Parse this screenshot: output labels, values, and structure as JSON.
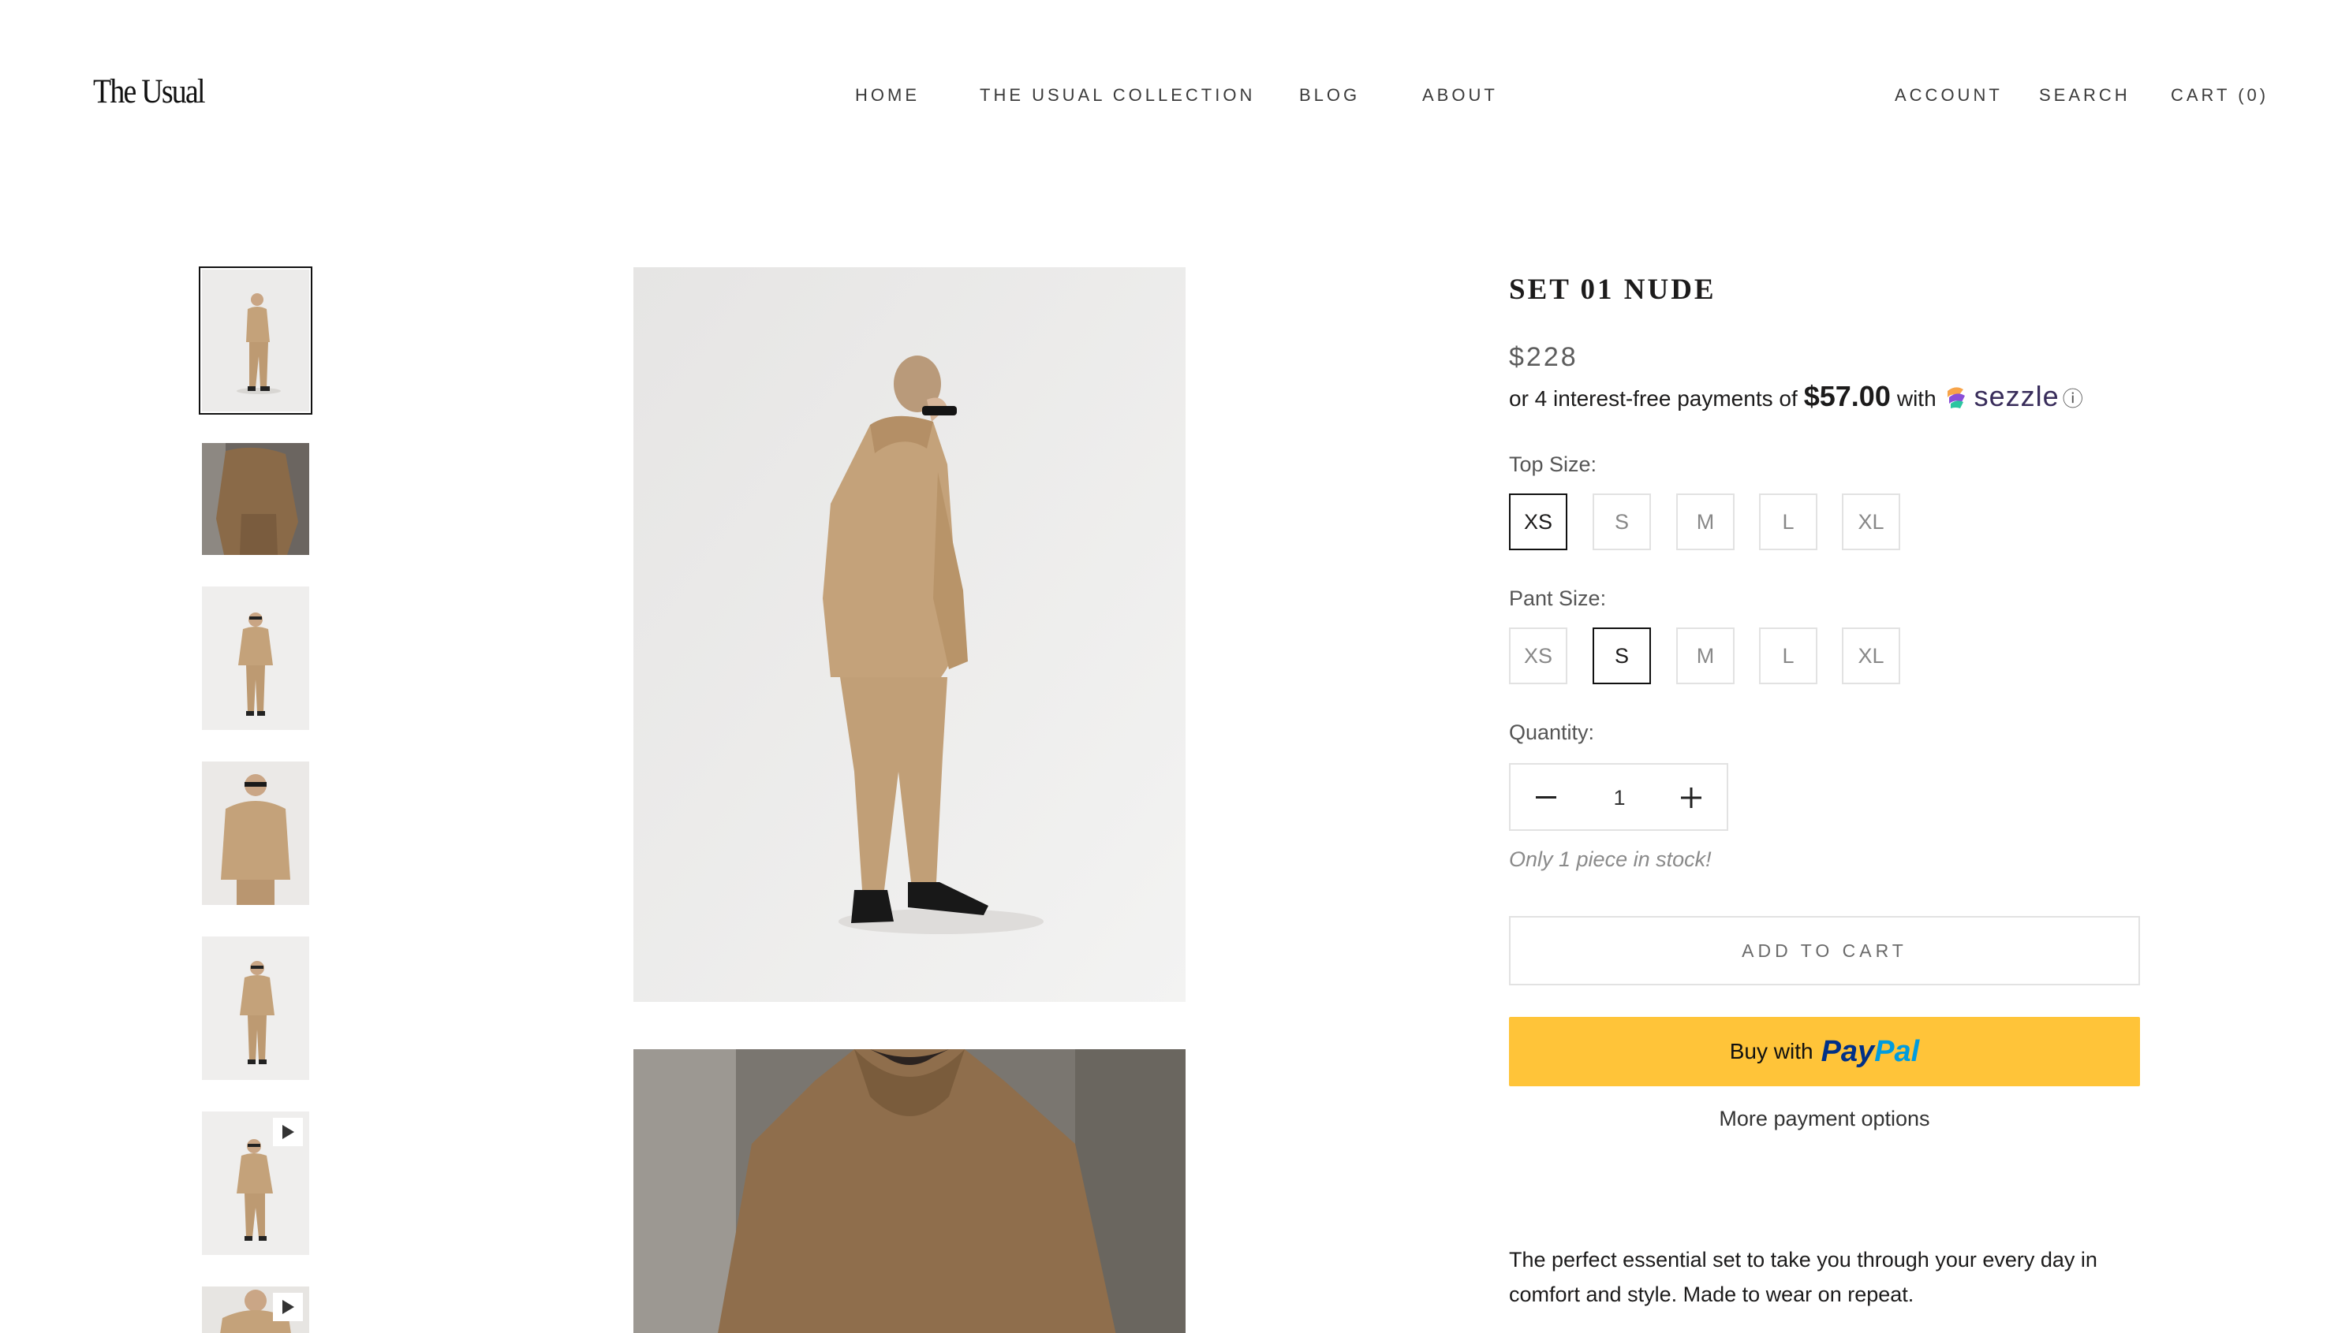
{
  "header": {
    "logo": "The Usual",
    "nav": [
      "HOME",
      "THE USUAL COLLECTION",
      "BLOG",
      "ABOUT"
    ],
    "account": "ACCOUNT",
    "search": "SEARCH",
    "cart": "CART (0)"
  },
  "gallery": {
    "thumbnail_count": 7,
    "selected_thumbnail": 1,
    "video_thumbnails": [
      6,
      7
    ]
  },
  "product": {
    "title": "SET 01 NUDE",
    "price": "$228",
    "installment": {
      "prefix": "or 4 interest-free payments of",
      "amount": "$57.00",
      "with": "with",
      "provider": "sezzle",
      "info_icon": "ⓘ"
    },
    "top_size": {
      "label": "Top Size:",
      "options": [
        "XS",
        "S",
        "M",
        "L",
        "XL"
      ],
      "selected": "XS"
    },
    "pant_size": {
      "label": "Pant Size:",
      "options": [
        "XS",
        "S",
        "M",
        "L",
        "XL"
      ],
      "selected": "S"
    },
    "quantity": {
      "label": "Quantity:",
      "value": "1"
    },
    "stock_note": "Only 1 piece in stock!",
    "add_to_cart": "ADD TO CART",
    "paypal": {
      "prefix": "Buy with",
      "pay": "Pay",
      "pal": "Pal"
    },
    "more_payment": "More payment options",
    "description": "The perfect essential set to take you through your every day in comfort and style. Made to wear on repeat."
  },
  "colors": {
    "paypal_yellow": "#ffc439",
    "paypal_dark_blue": "#003087",
    "paypal_light_blue": "#009cde",
    "outfit_tan": "#c4a27a",
    "selected_border": "#111111"
  }
}
